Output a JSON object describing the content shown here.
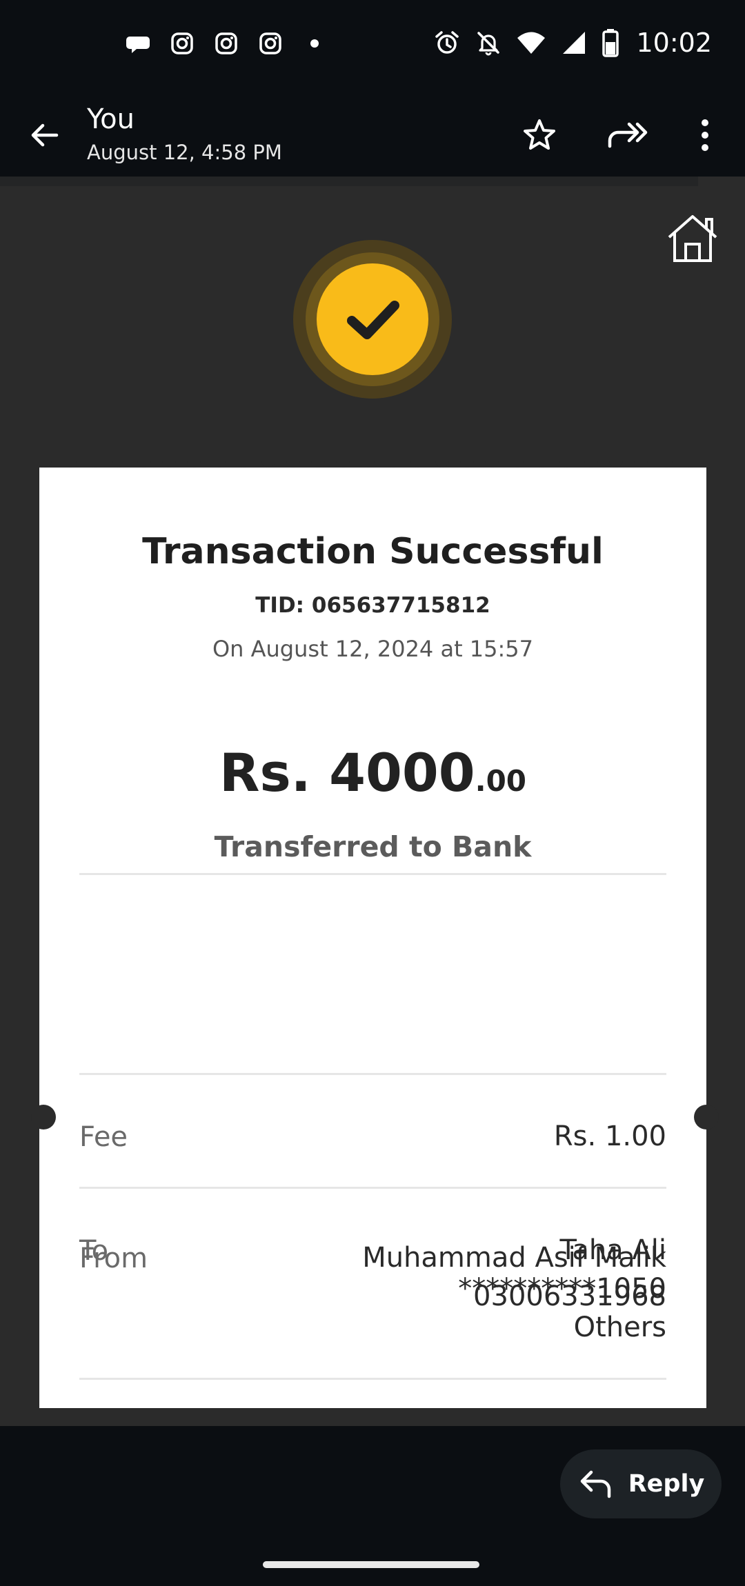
{
  "status_bar": {
    "time": "10:02",
    "left_icons": [
      "chat-bubble-icon",
      "instagram-icon",
      "instagram-icon",
      "instagram-icon",
      "dot-icon"
    ],
    "right_icons": [
      "alarm-icon",
      "notifications-off-icon",
      "wifi-icon",
      "signal-icon",
      "battery-icon"
    ]
  },
  "header": {
    "sender": "You",
    "date": "August 12, 4:58 PM",
    "actions": [
      "back-arrow-icon",
      "star-icon",
      "forward-icon",
      "more-vert-icon"
    ]
  },
  "receipt": {
    "title": "Transaction Successful",
    "tid": "TID: 065637715812",
    "datetime": "On August 12, 2024 at 15:57",
    "amount_main": "Rs. 4000",
    "amount_cents": ".00",
    "transfer_type": "Transferred to Bank",
    "fee": {
      "label": "Fee",
      "value": "Rs. 1.00"
    },
    "to": {
      "label": "To",
      "name": "Taha Ali",
      "account": "**********1050",
      "bank": "Others"
    },
    "from": {
      "label": "From",
      "name": "Muhammad Asif Malik",
      "phone": "03006331968"
    }
  },
  "footer": {
    "reply_label": "Reply"
  },
  "colors": {
    "accent_yellow": "#f9bb19",
    "background_dark": "#0b0e12",
    "image_bg": "#2b2b2b"
  }
}
